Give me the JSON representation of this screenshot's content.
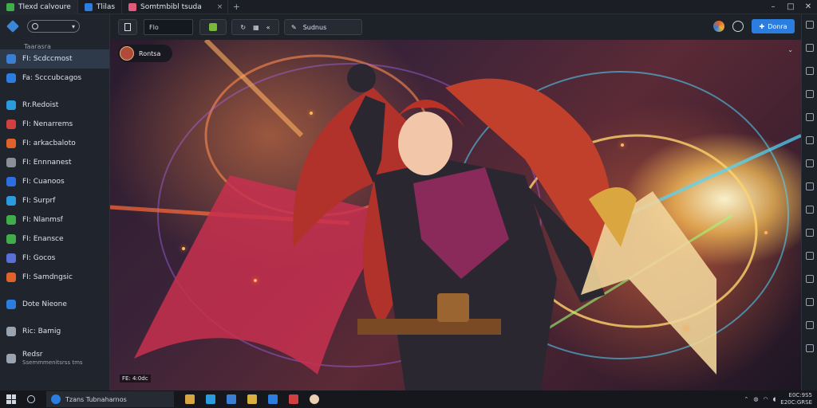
{
  "titlebar": {
    "tabs": [
      {
        "label": "Tlexd calvoure",
        "color": "#3fae4a"
      },
      {
        "label": "Tlilas",
        "color": "#2b7de0"
      },
      {
        "label": "Somtmbibl tsuda",
        "color": "#e05a7a",
        "close": "×"
      }
    ],
    "add": "+",
    "controls": {
      "min": "–",
      "max": "□",
      "close": "✕"
    }
  },
  "sidebar": {
    "select_label": "▾",
    "section_label": "Taarasra",
    "items": [
      {
        "label": "FI: Scdccmost",
        "color": "#3b7fd4",
        "active": true
      },
      {
        "label": "Fa: Scccubcagos",
        "color": "#2b7de0"
      },
      {
        "label": "Rr.Redoist",
        "color": "#2b9be0",
        "gap": true
      },
      {
        "label": "FI: Nenarrems",
        "color": "#d04040"
      },
      {
        "label": "FI: arkacbaloto",
        "color": "#e0622b"
      },
      {
        "label": "FI: Ennnanest",
        "color": "#8a9099"
      },
      {
        "label": "FI: Cuanoos",
        "color": "#2b6fe0"
      },
      {
        "label": "FI: Surprf",
        "color": "#2b9be0"
      },
      {
        "label": "FI: Nlanmsf",
        "color": "#3fae4a"
      },
      {
        "label": "FI: Enansce",
        "color": "#3fae4a"
      },
      {
        "label": "FI: Gocos",
        "color": "#5a6fd8"
      },
      {
        "label": "FI: Samdngsic",
        "color": "#e0622b"
      },
      {
        "label": "Dote Nieone",
        "color": "#2b7de0",
        "gap": true
      },
      {
        "label": "Ric: Bamig",
        "color": "#9aa3b0",
        "gap": true
      },
      {
        "label": "Redsr",
        "sub": "Ssemmmenitsrss tms",
        "color": "#9aa3b0",
        "gap": true
      }
    ]
  },
  "toolbar": {
    "input_value": "Flo",
    "action_label": "Sudnus",
    "primary_label": "Donra"
  },
  "viewport": {
    "hero_name": "Rontsa",
    "fps": "FE: 4:0dc"
  },
  "taskbar": {
    "search": "Tzans Tubnaharnos",
    "tray_time": "E0C:9S5",
    "tray_date": "E20C:GRSE"
  }
}
